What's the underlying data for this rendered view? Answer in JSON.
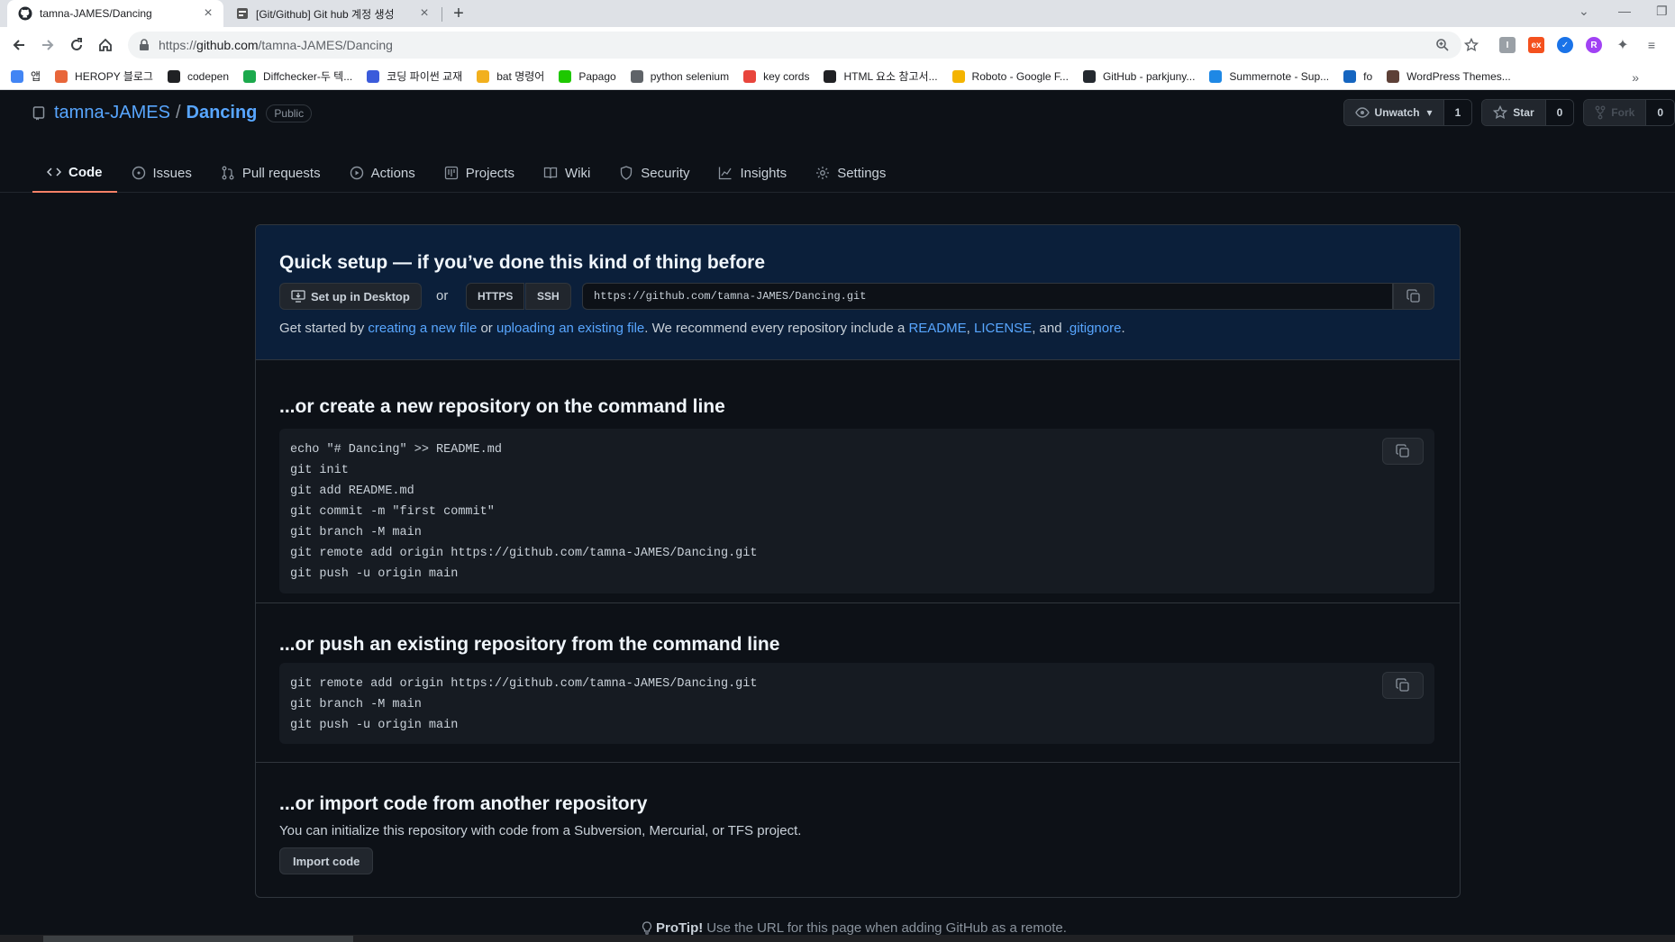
{
  "browser": {
    "tabs": [
      {
        "title": "tamna-JAMES/Dancing",
        "active": true,
        "favicon": "github-icon"
      },
      {
        "title": "[Git/Github] Git hub 계정 생성",
        "active": false,
        "favicon": "blog-icon"
      }
    ],
    "url_scheme": "https://",
    "url_host": "github.com",
    "url_path": "/tamna-JAMES/Dancing",
    "bookmarks": [
      {
        "label": "앱",
        "color": "#4285f4"
      },
      {
        "label": "HEROPY 블로그",
        "color": "#e8663a"
      },
      {
        "label": "codepen",
        "color": "#202124"
      },
      {
        "label": "Diffchecker-두 텍...",
        "color": "#1ba94c"
      },
      {
        "label": "코딩 파이썬 교재",
        "color": "#3b5bdb"
      },
      {
        "label": "bat 명령어",
        "color": "#f2b01e"
      },
      {
        "label": "Papago",
        "color": "#1ec800"
      },
      {
        "label": "python selenium",
        "color": "#5f6368"
      },
      {
        "label": "key cords",
        "color": "#e8453c"
      },
      {
        "label": "HTML 요소 참고서...",
        "color": "#202124"
      },
      {
        "label": "Roboto - Google F...",
        "color": "#f4b400"
      },
      {
        "label": "GitHub - parkjuny...",
        "color": "#24292f"
      },
      {
        "label": "Summernote - Sup...",
        "color": "#1e88e5"
      },
      {
        "label": "fo",
        "color": "#1565c0"
      },
      {
        "label": "WordPress Themes...",
        "color": "#5d4037"
      }
    ],
    "bookmarks_more": "»"
  },
  "repo": {
    "owner": "tamna-JAMES",
    "separator": "/",
    "name": "Dancing",
    "visibility": "Public",
    "watch_label": "Unwatch",
    "watch_count": "1",
    "star_label": "Star",
    "star_count": "0",
    "fork_label": "Fork",
    "fork_count": "0"
  },
  "nav": [
    {
      "label": "Code",
      "icon": "code-icon",
      "selected": true
    },
    {
      "label": "Issues",
      "icon": "issue-icon"
    },
    {
      "label": "Pull requests",
      "icon": "pull-request-icon"
    },
    {
      "label": "Actions",
      "icon": "play-icon"
    },
    {
      "label": "Projects",
      "icon": "project-icon"
    },
    {
      "label": "Wiki",
      "icon": "book-icon"
    },
    {
      "label": "Security",
      "icon": "shield-icon"
    },
    {
      "label": "Insights",
      "icon": "graph-icon"
    },
    {
      "label": "Settings",
      "icon": "gear-icon"
    }
  ],
  "quick_setup": {
    "title": "Quick setup — if you’ve done this kind of thing before",
    "desktop_button": "Set up in Desktop",
    "or": "or",
    "https_label": "HTTPS",
    "ssh_label": "SSH",
    "clone_url": "https://github.com/tamna-JAMES/Dancing.git",
    "hint_start": "Get started by ",
    "hint_link1": "creating a new file",
    "hint_or": " or ",
    "hint_link2": "uploading an existing file",
    "hint_mid": ". We recommend every repository include a ",
    "hint_readme": "README",
    "hint_comma": ", ",
    "hint_license": "LICENSE",
    "hint_and": ", and ",
    "hint_gitignore": ".gitignore",
    "hint_end": "."
  },
  "new_repo": {
    "title": "...or create a new repository on the command line",
    "lines": [
      "echo \"# Dancing\" >> README.md",
      "git init",
      "git add README.md",
      "git commit -m \"first commit\"",
      "git branch -M main",
      "git remote add origin https://github.com/tamna-JAMES/Dancing.git",
      "git push -u origin main"
    ]
  },
  "push_repo": {
    "title": "...or push an existing repository from the command line",
    "lines": [
      "git remote add origin https://github.com/tamna-JAMES/Dancing.git",
      "git branch -M main",
      "git push -u origin main"
    ]
  },
  "import_repo": {
    "title": "...or import code from another repository",
    "text": "You can initialize this repository with code from a Subversion, Mercurial, or TFS project.",
    "button": "Import code"
  },
  "protip": {
    "label": "ProTip!",
    "text": "Use the URL for this page when adding GitHub as a remote."
  },
  "colors": {
    "background": "#0d1117",
    "link": "#58a6ff",
    "selected_tab_underline": "#f78166",
    "quick_setup_bg": "#0b1f3a"
  }
}
